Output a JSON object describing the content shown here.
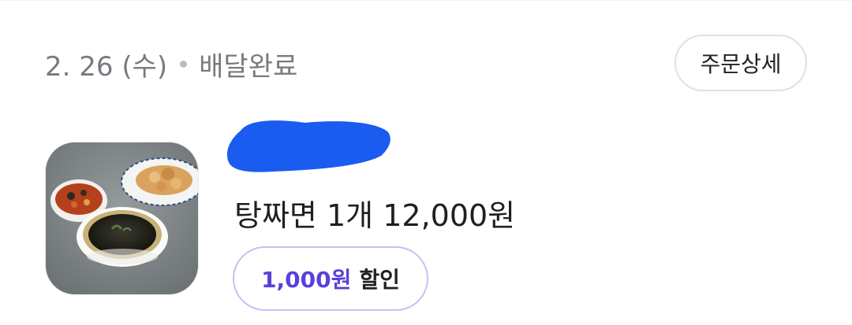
{
  "order": {
    "date": "2. 26 (수)",
    "status": "배달완료",
    "detail_button_label": "주문상세"
  },
  "store": {
    "name_redacted": true
  },
  "item": {
    "name": "탕짜면",
    "quantity": "1개",
    "price": "12,000원"
  },
  "discount": {
    "amount": "1,000원",
    "label": "할인"
  },
  "colors": {
    "accent": "#5a40d9",
    "pill_border": "#c7bff3",
    "redaction": "#1a5cf0",
    "muted_text": "#777b80"
  }
}
